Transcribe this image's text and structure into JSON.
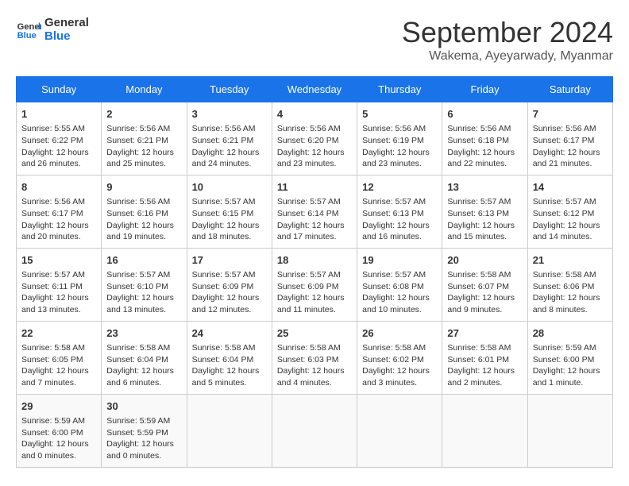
{
  "header": {
    "logo_line1": "General",
    "logo_line2": "Blue",
    "month": "September 2024",
    "location": "Wakema, Ayeyarwady, Myanmar"
  },
  "days_of_week": [
    "Sunday",
    "Monday",
    "Tuesday",
    "Wednesday",
    "Thursday",
    "Friday",
    "Saturday"
  ],
  "weeks": [
    [
      {
        "day": 1,
        "lines": [
          "Sunrise: 5:55 AM",
          "Sunset: 6:22 PM",
          "Daylight: 12 hours",
          "and 26 minutes."
        ]
      },
      {
        "day": 2,
        "lines": [
          "Sunrise: 5:56 AM",
          "Sunset: 6:21 PM",
          "Daylight: 12 hours",
          "and 25 minutes."
        ]
      },
      {
        "day": 3,
        "lines": [
          "Sunrise: 5:56 AM",
          "Sunset: 6:21 PM",
          "Daylight: 12 hours",
          "and 24 minutes."
        ]
      },
      {
        "day": 4,
        "lines": [
          "Sunrise: 5:56 AM",
          "Sunset: 6:20 PM",
          "Daylight: 12 hours",
          "and 23 minutes."
        ]
      },
      {
        "day": 5,
        "lines": [
          "Sunrise: 5:56 AM",
          "Sunset: 6:19 PM",
          "Daylight: 12 hours",
          "and 23 minutes."
        ]
      },
      {
        "day": 6,
        "lines": [
          "Sunrise: 5:56 AM",
          "Sunset: 6:18 PM",
          "Daylight: 12 hours",
          "and 22 minutes."
        ]
      },
      {
        "day": 7,
        "lines": [
          "Sunrise: 5:56 AM",
          "Sunset: 6:17 PM",
          "Daylight: 12 hours",
          "and 21 minutes."
        ]
      }
    ],
    [
      {
        "day": 8,
        "lines": [
          "Sunrise: 5:56 AM",
          "Sunset: 6:17 PM",
          "Daylight: 12 hours",
          "and 20 minutes."
        ]
      },
      {
        "day": 9,
        "lines": [
          "Sunrise: 5:56 AM",
          "Sunset: 6:16 PM",
          "Daylight: 12 hours",
          "and 19 minutes."
        ]
      },
      {
        "day": 10,
        "lines": [
          "Sunrise: 5:57 AM",
          "Sunset: 6:15 PM",
          "Daylight: 12 hours",
          "and 18 minutes."
        ]
      },
      {
        "day": 11,
        "lines": [
          "Sunrise: 5:57 AM",
          "Sunset: 6:14 PM",
          "Daylight: 12 hours",
          "and 17 minutes."
        ]
      },
      {
        "day": 12,
        "lines": [
          "Sunrise: 5:57 AM",
          "Sunset: 6:13 PM",
          "Daylight: 12 hours",
          "and 16 minutes."
        ]
      },
      {
        "day": 13,
        "lines": [
          "Sunrise: 5:57 AM",
          "Sunset: 6:13 PM",
          "Daylight: 12 hours",
          "and 15 minutes."
        ]
      },
      {
        "day": 14,
        "lines": [
          "Sunrise: 5:57 AM",
          "Sunset: 6:12 PM",
          "Daylight: 12 hours",
          "and 14 minutes."
        ]
      }
    ],
    [
      {
        "day": 15,
        "lines": [
          "Sunrise: 5:57 AM",
          "Sunset: 6:11 PM",
          "Daylight: 12 hours",
          "and 13 minutes."
        ]
      },
      {
        "day": 16,
        "lines": [
          "Sunrise: 5:57 AM",
          "Sunset: 6:10 PM",
          "Daylight: 12 hours",
          "and 13 minutes."
        ]
      },
      {
        "day": 17,
        "lines": [
          "Sunrise: 5:57 AM",
          "Sunset: 6:09 PM",
          "Daylight: 12 hours",
          "and 12 minutes."
        ]
      },
      {
        "day": 18,
        "lines": [
          "Sunrise: 5:57 AM",
          "Sunset: 6:09 PM",
          "Daylight: 12 hours",
          "and 11 minutes."
        ]
      },
      {
        "day": 19,
        "lines": [
          "Sunrise: 5:57 AM",
          "Sunset: 6:08 PM",
          "Daylight: 12 hours",
          "and 10 minutes."
        ]
      },
      {
        "day": 20,
        "lines": [
          "Sunrise: 5:58 AM",
          "Sunset: 6:07 PM",
          "Daylight: 12 hours",
          "and 9 minutes."
        ]
      },
      {
        "day": 21,
        "lines": [
          "Sunrise: 5:58 AM",
          "Sunset: 6:06 PM",
          "Daylight: 12 hours",
          "and 8 minutes."
        ]
      }
    ],
    [
      {
        "day": 22,
        "lines": [
          "Sunrise: 5:58 AM",
          "Sunset: 6:05 PM",
          "Daylight: 12 hours",
          "and 7 minutes."
        ]
      },
      {
        "day": 23,
        "lines": [
          "Sunrise: 5:58 AM",
          "Sunset: 6:04 PM",
          "Daylight: 12 hours",
          "and 6 minutes."
        ]
      },
      {
        "day": 24,
        "lines": [
          "Sunrise: 5:58 AM",
          "Sunset: 6:04 PM",
          "Daylight: 12 hours",
          "and 5 minutes."
        ]
      },
      {
        "day": 25,
        "lines": [
          "Sunrise: 5:58 AM",
          "Sunset: 6:03 PM",
          "Daylight: 12 hours",
          "and 4 minutes."
        ]
      },
      {
        "day": 26,
        "lines": [
          "Sunrise: 5:58 AM",
          "Sunset: 6:02 PM",
          "Daylight: 12 hours",
          "and 3 minutes."
        ]
      },
      {
        "day": 27,
        "lines": [
          "Sunrise: 5:58 AM",
          "Sunset: 6:01 PM",
          "Daylight: 12 hours",
          "and 2 minutes."
        ]
      },
      {
        "day": 28,
        "lines": [
          "Sunrise: 5:59 AM",
          "Sunset: 6:00 PM",
          "Daylight: 12 hours",
          "and 1 minute."
        ]
      }
    ],
    [
      {
        "day": 29,
        "lines": [
          "Sunrise: 5:59 AM",
          "Sunset: 6:00 PM",
          "Daylight: 12 hours",
          "and 0 minutes."
        ]
      },
      {
        "day": 30,
        "lines": [
          "Sunrise: 5:59 AM",
          "Sunset: 5:59 PM",
          "Daylight: 12 hours",
          "and 0 minutes."
        ]
      },
      null,
      null,
      null,
      null,
      null
    ]
  ]
}
